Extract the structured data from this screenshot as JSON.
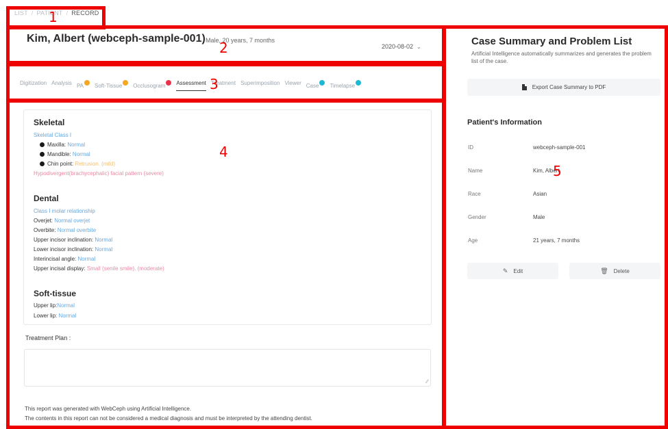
{
  "breadcrumb": {
    "items": [
      "LIST",
      "PATIENT",
      "RECORD"
    ]
  },
  "header": {
    "patient_name": "Kim, Albert (webceph-sample-001)",
    "patient_meta": "Male, 20 years, 7 months",
    "record_date": "2020-08-02"
  },
  "tabs": [
    {
      "label": "Digitization",
      "badge": ""
    },
    {
      "label": "Analysis",
      "badge": ""
    },
    {
      "label": "PA",
      "badge": "orange"
    },
    {
      "label": "Soft-Tissue",
      "badge": "orange"
    },
    {
      "label": "Occlusogram",
      "badge": "red"
    },
    {
      "label": "Assessment",
      "badge": ""
    },
    {
      "label": "Treatment",
      "badge": ""
    },
    {
      "label": "Superimposition",
      "badge": ""
    },
    {
      "label": "Viewer",
      "badge": ""
    },
    {
      "label": "Case",
      "badge": "teal"
    },
    {
      "label": "Timelapse",
      "badge": "teal"
    }
  ],
  "assessment": {
    "skeletal": {
      "title": "Skeletal",
      "class_text": "Skeletal Class I",
      "maxilla_label": "Maxilla:",
      "maxilla_value": "Normal",
      "mandible_label": "Mandible:",
      "mandible_value": "Normal",
      "chin_label": "Chin point:",
      "chin_value": "Retrusion. (mild)",
      "pattern": "Hypodivergent(brachycephalic) facial pattern (severe)"
    },
    "dental": {
      "title": "Dental",
      "molar": "Class I molar relationship",
      "overjet_label": "Overjet:",
      "overjet_value": "Normal overjet",
      "overbite_label": "Overbite:",
      "overbite_value": "Normal overbite",
      "upper_incl_label": "Upper incisor inclination:",
      "upper_incl_value": "Normal",
      "lower_incl_label": "Lower incisor inclination:",
      "lower_incl_value": "Normal",
      "interincisal_label": "Interincisal angle:",
      "interincisal_value": "Normal",
      "display_label": "Upper incisal display:",
      "display_value": "Small (senile smile). (moderate)"
    },
    "soft_tissue": {
      "title": "Soft-tissue",
      "upper_lip_label": "Upper lip:",
      "upper_lip_value": "Normal",
      "lower_lip_label": "Lower lip:",
      "lower_lip_value": "Normal"
    }
  },
  "treatment_plan": {
    "label": "Treatment Plan :",
    "value": ""
  },
  "footer": {
    "line1": "This report was generated with WebCeph using Artificial Intelligence.",
    "line2": "The contents in this report can not be considered a medical diagnosis and must be interpreted by the attending dentist."
  },
  "right_panel": {
    "title": "Case Summary and Problem List",
    "description": "Artificial Intelligence automatically summarizes and generates the problem list of the case.",
    "export_label": "Export Case Summary to PDF",
    "info_title": "Patient's Information",
    "fields": [
      {
        "key": "ID",
        "value": "webceph-sample-001"
      },
      {
        "key": "Name",
        "value": "Kim, Albert"
      },
      {
        "key": "Race",
        "value": "Asian"
      },
      {
        "key": "Gender",
        "value": "Male"
      },
      {
        "key": "Age",
        "value": "21 years, 7 months"
      }
    ],
    "edit_label": "Edit",
    "delete_label": "Delete"
  },
  "annotations": [
    "1",
    "2",
    "3",
    "4",
    "5"
  ],
  "colors": {
    "annotation": "#ee0000",
    "value_blue": "#6aa7dd",
    "value_pink": "#e88aa3",
    "value_orange": "#f2c07a"
  }
}
